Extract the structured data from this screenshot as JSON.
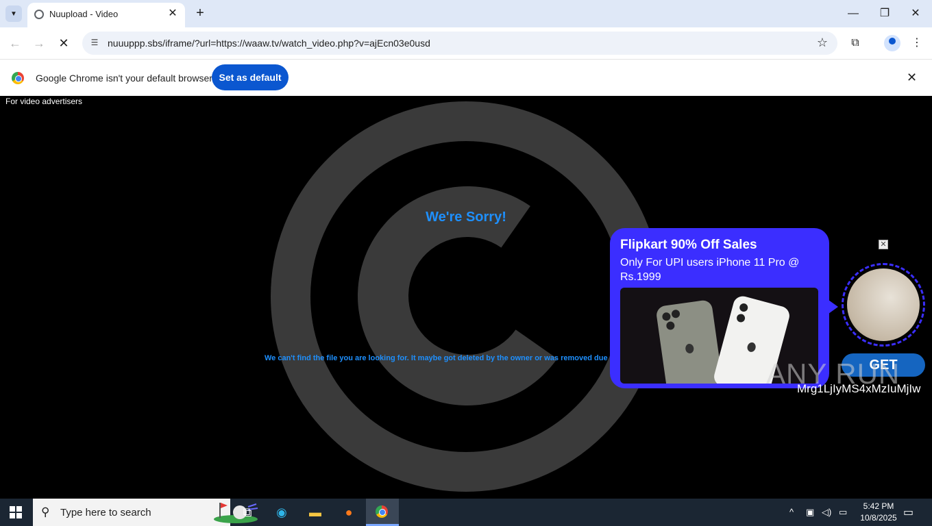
{
  "browser": {
    "tab_title": "Nuupload - Video",
    "url": "nuuuppp.sbs/iframe/?url=https://waaw.tv/watch_video.php?v=ajEcn03e0usd",
    "infobar_text": "Google Chrome isn't your default browser",
    "set_default_label": "Set as default"
  },
  "page": {
    "advertisers_label": "For video advertisers",
    "sorry_title": "We're Sorry!",
    "message": "We can't find the file you are looking for. It maybe got deleted by the owner or was removed due a co"
  },
  "ad": {
    "title": "Flipkart 90% Off Sales",
    "subtitle": "Only For UPI users iPhone 11 Pro @ Rs.1999",
    "get_label": "GET",
    "close_label": "✕"
  },
  "watermark": {
    "brand": "ANY RUN",
    "id_text": "Mrg1LjIyMS4xMzIuMjIw"
  },
  "taskbar": {
    "search_placeholder": "Type here to search",
    "time": "5:42 PM",
    "date": "10/8/2025"
  },
  "colors": {
    "accent": "#0b57d0",
    "error_blue": "#1e90ff",
    "ad_purple": "#3b2eff"
  }
}
